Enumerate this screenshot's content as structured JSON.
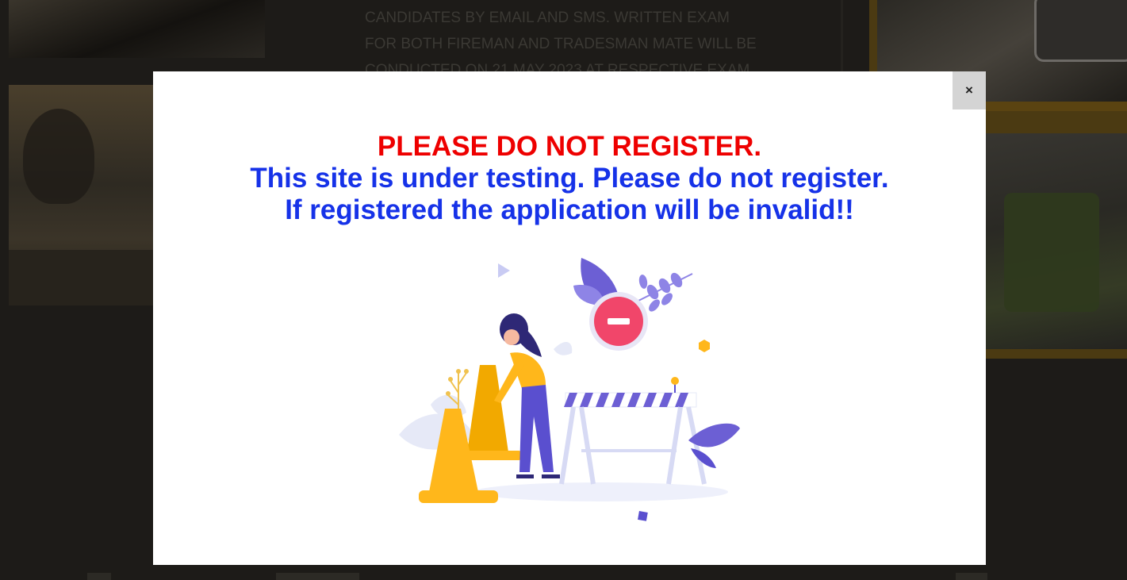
{
  "background": {
    "text_lines": [
      "CANDIDATES BY EMAIL AND SMS. WRITTEN EXAM",
      "FOR BOTH FIREMAN AND TRADESMAN MATE WILL BE",
      "CONDUCTED ON 21 MAY 2023 AT RESPECTIVE EXAM"
    ]
  },
  "modal": {
    "close_label": "×",
    "line1": "PLEASE DO NOT REGISTER.",
    "line2": "This site is under testing. Please do not register.",
    "line3": "If registered the application will be invalid!!",
    "colors": {
      "warning_red": "#ee0000",
      "message_blue": "#1632e8",
      "accent_purple": "#6c5fd4",
      "accent_yellow": "#ffb71b",
      "stop_pink": "#f1466a"
    },
    "illustration_icon": "under-construction-illustration"
  }
}
